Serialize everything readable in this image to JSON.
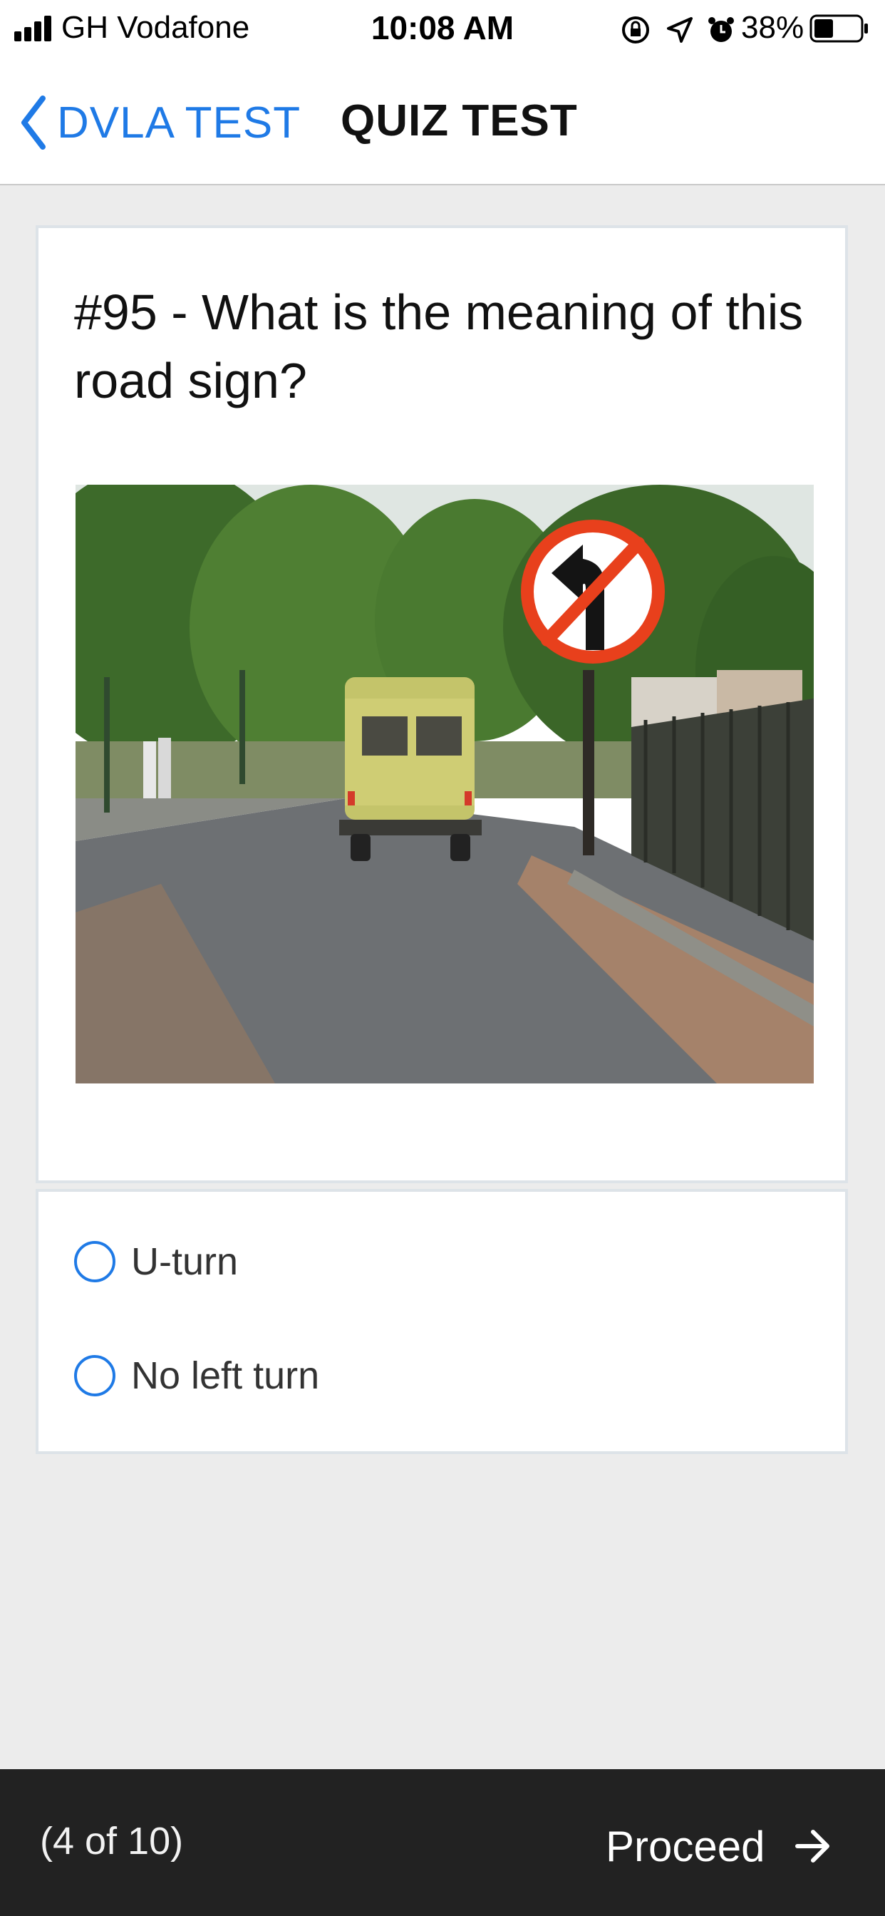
{
  "status_bar": {
    "carrier": "GH Vodafone",
    "time": "10:08 AM",
    "battery_percent": "38%",
    "icons": [
      "signal-bars-icon",
      "rotation-lock-icon",
      "location-arrow-icon",
      "alarm-icon",
      "battery-icon"
    ]
  },
  "nav": {
    "back_label": "DVLA TEST",
    "title": "QUIZ TEST"
  },
  "question": {
    "text": "#95 - What is the meaning of this road sign?"
  },
  "options": [
    {
      "label": "U-turn",
      "selected": false
    },
    {
      "label": "No left turn",
      "selected": false
    }
  ],
  "footer": {
    "progress": "(4 of 10)",
    "proceed_label": "Proceed"
  },
  "colors": {
    "accent": "#1f7ae6",
    "background": "#ececec",
    "footer": "#222222",
    "sign_red": "#e8401c"
  }
}
